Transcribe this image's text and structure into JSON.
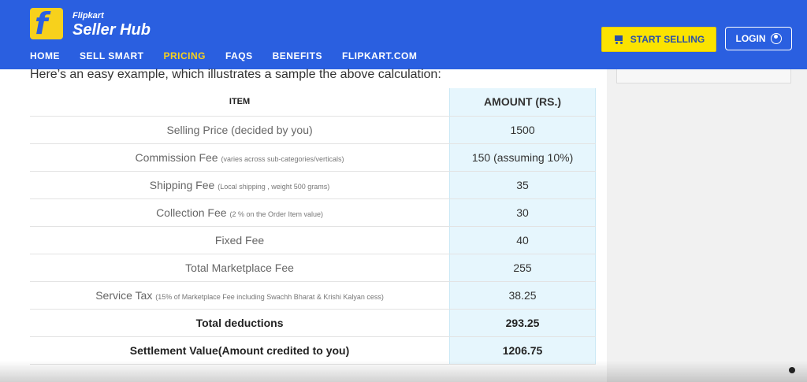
{
  "brand": {
    "small": "Flipkart",
    "big": "Seller Hub",
    "icon": "flipkart-logo-icon"
  },
  "nav": [
    "HOME",
    "SELL SMART",
    "PRICING",
    "FAQS",
    "BENEFITS",
    "FLIPKART.COM"
  ],
  "active_nav": "PRICING",
  "buttons": {
    "start_selling": "START SELLING",
    "login": "LOGIN"
  },
  "intro": "Here’s an easy example, which illustrates a sample the above calculation:",
  "table": {
    "headers": {
      "item": "ITEM",
      "amount": "AMOUNT (RS.)"
    },
    "rows": [
      {
        "item": "Selling Price (decided by you)",
        "note": "",
        "amount": "1500"
      },
      {
        "item": "Commission Fee",
        "note": "(varies across sub-categories/verticals)",
        "amount": "150 (assuming 10%)"
      },
      {
        "item": "Shipping Fee",
        "note": "(Local shipping , weight 500 grams)",
        "amount": "35"
      },
      {
        "item": "Collection Fee",
        "note": "(2 % on the Order Item value)",
        "amount": "30"
      },
      {
        "item": "Fixed Fee",
        "note": "",
        "amount": "40"
      },
      {
        "item": "Total Marketplace Fee",
        "note": "",
        "amount": "255"
      },
      {
        "item": "Service Tax",
        "note": "(15% of Marketplace Fee including Swachh Bharat & Krishi Kalyan cess)",
        "amount": "38.25"
      },
      {
        "item": "Total deductions",
        "note": "",
        "amount": "293.25"
      },
      {
        "item": "Settlement Value(Amount credited to you)",
        "note": "",
        "amount": "1206.75"
      }
    ]
  },
  "colors": {
    "header": "#2a5fe0",
    "accent": "#f7d11c",
    "amount_col": "#e6f6fd"
  }
}
